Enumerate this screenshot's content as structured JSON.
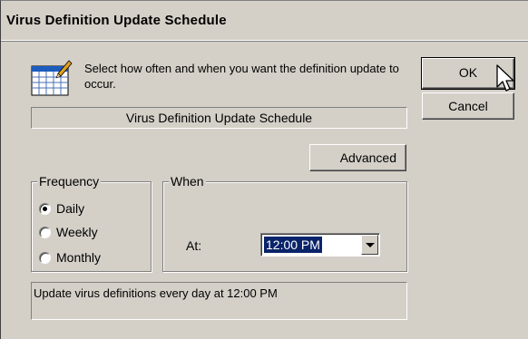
{
  "dialog": {
    "title": "Virus Definition Update Schedule",
    "intro": "Select how often and when you want the definition update to occur.",
    "schedule_name": "Virus Definition Update Schedule",
    "description": "Update virus definitions every day at 12:00 PM"
  },
  "buttons": {
    "ok": "OK",
    "cancel": "Cancel",
    "advanced": "Advanced"
  },
  "frequency": {
    "legend": "Frequency",
    "options": [
      {
        "label": "Daily",
        "checked": true
      },
      {
        "label": "Weekly",
        "checked": false
      },
      {
        "label": "Monthly",
        "checked": false
      }
    ]
  },
  "when": {
    "legend": "When",
    "at_label": "At:",
    "time_value": "12:00 PM"
  },
  "icons": {
    "calendar": "calendar-pencil-icon",
    "cursor": "mouse-pointer-icon",
    "dropdown": "chevron-down-icon"
  },
  "colors": {
    "face": "#d4d0c8",
    "selection": "#0a246a"
  }
}
